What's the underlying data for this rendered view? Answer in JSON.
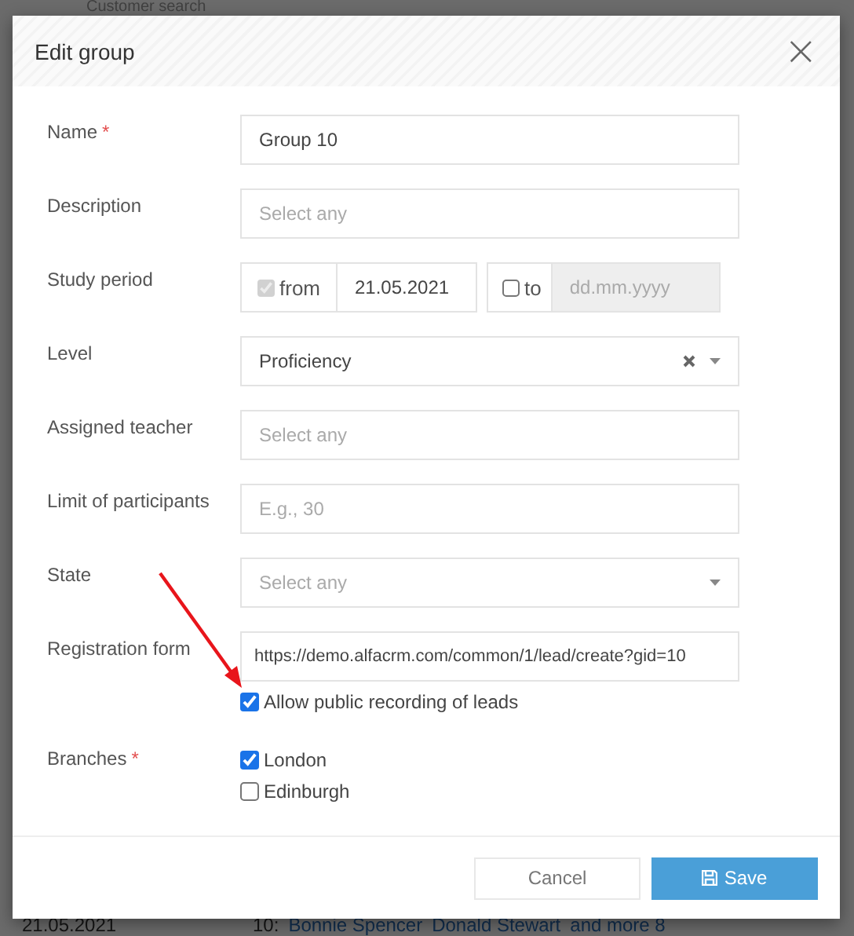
{
  "background": {
    "search_label": "Customer search",
    "row": {
      "date": "21.05.2021",
      "count": "10:",
      "names": [
        "Bonnie Spencer",
        "Donald Stewart"
      ],
      "more": "and more 8"
    }
  },
  "dialog": {
    "title": "Edit group",
    "close": "×",
    "fields": [
      {
        "kind": "text",
        "label": "Name",
        "required_mark": "*",
        "value": "Group 10"
      },
      {
        "kind": "text",
        "label": "Description",
        "placeholder": "Select any"
      },
      {
        "kind": "period",
        "label": "Study period",
        "from": {
          "label": "from",
          "checked": true,
          "disabled": true,
          "value": "21.05.2021"
        },
        "to": {
          "label": "to",
          "checked": false,
          "disabled": true,
          "placeholder": "dd.mm.yyyy"
        }
      },
      {
        "kind": "select",
        "label": "Level",
        "value": "Proficiency",
        "clearable": true
      },
      {
        "kind": "text",
        "label": "Assigned teacher",
        "placeholder": "Select any"
      },
      {
        "kind": "text",
        "label": "Limit of participants",
        "placeholder": "E.g., 30"
      },
      {
        "kind": "select",
        "label": "State",
        "placeholder": "Select any",
        "clearable": false
      },
      {
        "kind": "link",
        "label": "Registration form",
        "value": "https://demo.alfacrm.com/common/1/lead/create?gid=10",
        "option": {
          "label": "Allow public recording of leads",
          "checked": true
        }
      },
      {
        "kind": "checkboxes",
        "label": "Branches",
        "required_mark": "*",
        "options": [
          {
            "label": "London",
            "checked": true
          },
          {
            "label": "Edinburgh",
            "checked": false
          }
        ]
      }
    ],
    "buttons": {
      "cancel": "Cancel",
      "save": "Save"
    }
  }
}
